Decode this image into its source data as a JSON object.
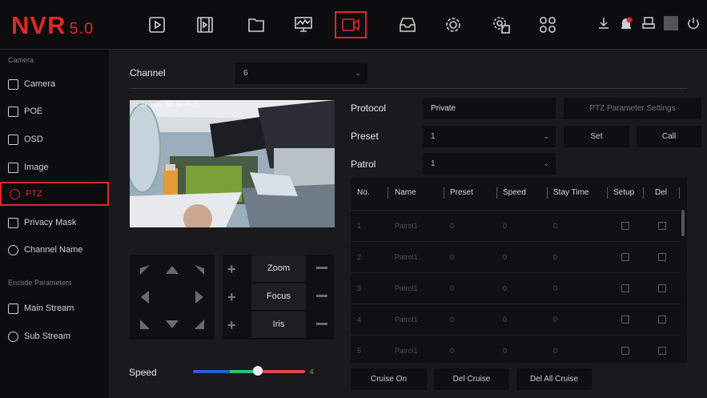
{
  "app": {
    "logo": "NVR",
    "version": "5.0"
  },
  "topnav": {
    "items": [
      {
        "name": "playback-icon"
      },
      {
        "name": "video-clip-icon"
      },
      {
        "name": "folder-icon"
      },
      {
        "name": "monitor-chart-icon"
      },
      {
        "name": "camera-icon",
        "active": true
      },
      {
        "name": "storage-icon"
      },
      {
        "name": "settings-gear-icon"
      },
      {
        "name": "system-settings-icon"
      },
      {
        "name": "grid-apps-icon"
      }
    ],
    "right_icons": [
      "download-icon",
      "alarm-icon",
      "stamp-icon",
      "power-icon"
    ]
  },
  "sidebar": {
    "section_camera": "Camera",
    "section_encode": "Encode Parameters",
    "items": [
      {
        "label": "Camera",
        "icon": "camera-icon"
      },
      {
        "label": "POE",
        "icon": "poe-icon"
      },
      {
        "label": "OSD",
        "icon": "osd-icon"
      },
      {
        "label": "Image",
        "icon": "image-icon"
      },
      {
        "label": "PTZ",
        "icon": "ptz-icon",
        "active": true
      },
      {
        "label": "Privacy Mask",
        "icon": "privacy-mask-icon"
      },
      {
        "label": "Channel Name",
        "icon": "channel-name-icon"
      },
      {
        "label": "Main Stream",
        "icon": "main-stream-icon"
      },
      {
        "label": "Sub Stream",
        "icon": "sub-stream-icon"
      }
    ]
  },
  "channel": {
    "label": "Channel",
    "value": "6"
  },
  "video": {
    "osd": "12-06-2020 TUE 00:00:23"
  },
  "ptz_controls": {
    "zoom": "Zoom",
    "focus": "Focus",
    "iris": "Iris",
    "speed_label": "Speed",
    "speed_value": "4",
    "speed_fraction": 0.58
  },
  "protocol": {
    "label": "Protocol",
    "value": "Private",
    "settings_button": "PTZ Parameter Settings"
  },
  "preset": {
    "label": "Preset",
    "value": "1",
    "set_button": "Set",
    "call_button": "Call"
  },
  "patrol": {
    "label": "Patrol",
    "value": "1"
  },
  "table": {
    "headers": [
      "No.",
      "Name",
      "Preset",
      "Speed",
      "Stay Time",
      "Setup",
      "Del"
    ],
    "rows": [
      {
        "no": "1",
        "name": "Patrol1",
        "preset": "0",
        "speed": "0",
        "stay": "0"
      },
      {
        "no": "2",
        "name": "Patrol1",
        "preset": "0",
        "speed": "0",
        "stay": "0"
      },
      {
        "no": "3",
        "name": "Patrol1",
        "preset": "0",
        "speed": "0",
        "stay": "0"
      },
      {
        "no": "4",
        "name": "Patrol1",
        "preset": "0",
        "speed": "0",
        "stay": "0"
      },
      {
        "no": "5",
        "name": "Patrol1",
        "preset": "0",
        "speed": "0",
        "stay": "0"
      }
    ]
  },
  "buttons": {
    "cruise_on": "Cruise On",
    "del_cruise": "Del Cruise",
    "del_all_cruise": "Del All Cruise"
  },
  "colors": {
    "accent": "#e0262a",
    "background": "#1a1a1d",
    "sidebar": "#0d0d0f"
  }
}
